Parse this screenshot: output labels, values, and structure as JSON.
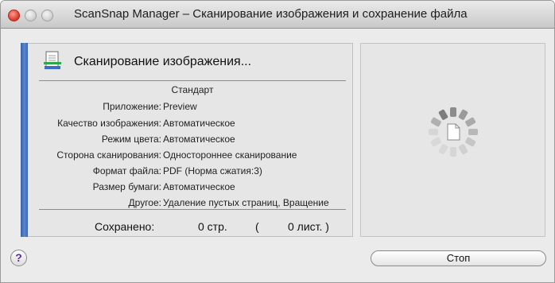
{
  "window": {
    "title": "ScanSnap Manager – Сканирование изображения и сохранение файла"
  },
  "status": {
    "text": "Сканирование изображения...",
    "icon": "scan-document-icon"
  },
  "profile": "Стандарт",
  "settings": [
    {
      "label": "Приложение:",
      "value": "Preview"
    },
    {
      "label": "Качество изображения:",
      "value": "Автоматическое"
    },
    {
      "label": "Режим цвета:",
      "value": "Автоматическое"
    },
    {
      "label": "Сторона сканирования:",
      "value": "Одностороннее сканирование"
    },
    {
      "label": "Формат файла:",
      "value": "PDF (Норма сжатия:3)"
    },
    {
      "label": "Размер бумаги:",
      "value": "Автоматическое"
    },
    {
      "label": "Другое:",
      "value": "Удаление пустых страниц, Вращение"
    }
  ],
  "saved": {
    "label": "Сохранено:",
    "pages": "0 стр.",
    "paren_open": "(",
    "sheets": "0 лист. )"
  },
  "buttons": {
    "help": "?",
    "stop": "Стоп"
  },
  "colors": {
    "accent": "#3a68b3",
    "help_mark": "#5b2ea0"
  }
}
